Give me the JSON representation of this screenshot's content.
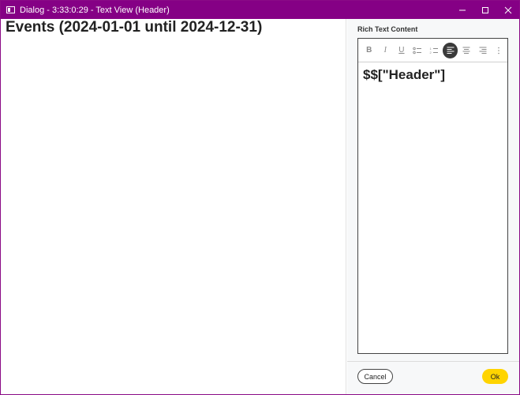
{
  "window": {
    "title": "Dialog - 3:33:0:29 - Text View (Header)",
    "title_color": "#850085"
  },
  "preview": {
    "heading": "Events (2024-01-01 until 2024-12-31)"
  },
  "editor": {
    "label": "Rich Text Content",
    "content": "$$[\"Header\"]",
    "toolbar": {
      "bold": "B",
      "italic": "I",
      "underline": "U"
    }
  },
  "footer": {
    "cancel_label": "Cancel",
    "ok_label": "Ok",
    "ok_color": "#ffd400"
  }
}
